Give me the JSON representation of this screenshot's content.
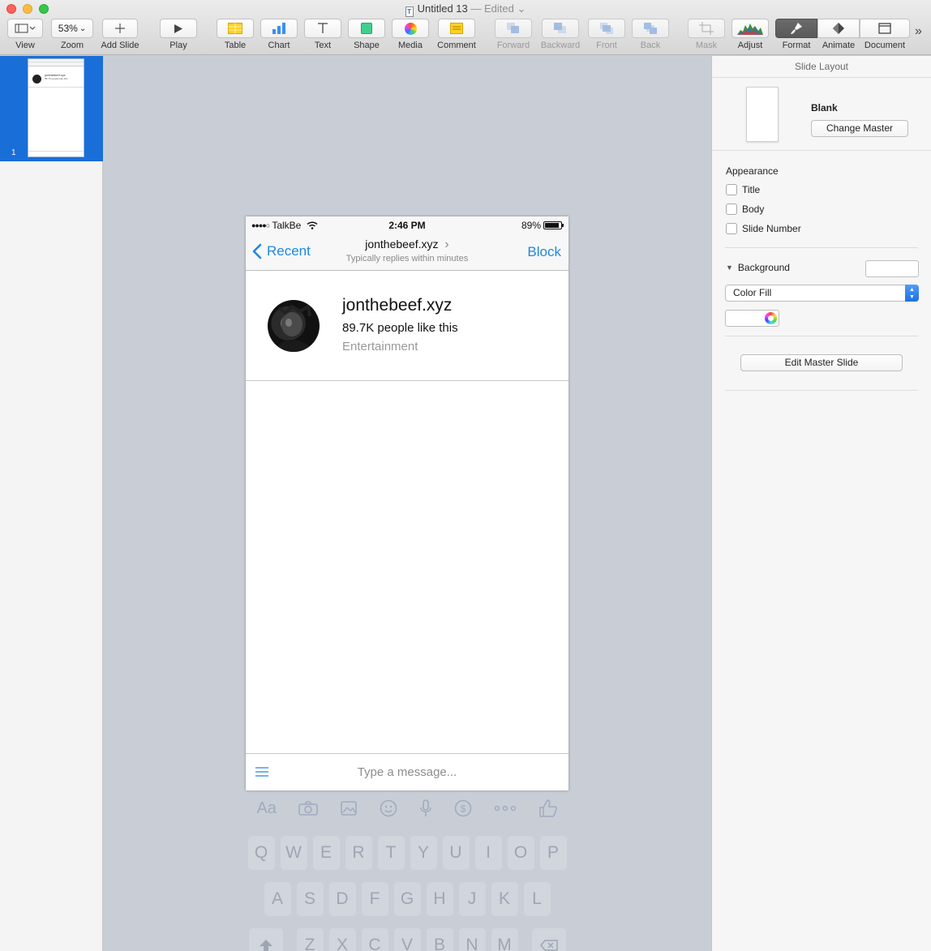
{
  "window": {
    "title": "Untitled 13",
    "status": "— Edited",
    "doc_icon_letter": "T"
  },
  "toolbar": {
    "view": {
      "label": "View",
      "icon": "sidebar-layout-icon"
    },
    "zoom": {
      "label": "Zoom",
      "value": "53%"
    },
    "add_slide": {
      "label": "Add Slide",
      "icon": "plus-icon"
    },
    "play": {
      "label": "Play",
      "icon": "play-icon"
    },
    "table": {
      "label": "Table",
      "icon": "table-icon"
    },
    "chart": {
      "label": "Chart",
      "icon": "bar-chart-icon"
    },
    "text": {
      "label": "Text",
      "icon": "text-t-icon"
    },
    "shape": {
      "label": "Shape",
      "icon": "shape-square-icon"
    },
    "media": {
      "label": "Media",
      "icon": "photos-flower-icon"
    },
    "comment": {
      "label": "Comment",
      "icon": "comment-note-icon"
    },
    "forward": {
      "label": "Forward",
      "enabled": false
    },
    "backward": {
      "label": "Backward",
      "enabled": false
    },
    "front": {
      "label": "Front",
      "enabled": false
    },
    "back": {
      "label": "Back",
      "enabled": false
    },
    "mask": {
      "label": "Mask",
      "enabled": false
    },
    "adjust": {
      "label": "Adjust",
      "icon": "histogram-icon"
    },
    "format": {
      "label": "Format",
      "icon": "paintbrush-icon",
      "active": true
    },
    "animate": {
      "label": "Animate",
      "icon": "diamond-icon"
    },
    "document": {
      "label": "Document",
      "icon": "document-rect-icon"
    },
    "overflow": "»"
  },
  "navigator": {
    "slide_number": "1",
    "thumb": {
      "name": "jonthebeef.xyz",
      "likes": "89.7K people like this"
    }
  },
  "slide": {
    "status_bar": {
      "signal": "●●●●○",
      "carrier": "TalkBe",
      "time": "2:46 PM",
      "battery_text": "89%",
      "battery_level": 0.89
    },
    "nav": {
      "back_label": "Recent",
      "title": "jonthebeef.xyz",
      "title_chevron": "›",
      "subtitle": "Typically replies within minutes",
      "block_label": "Block"
    },
    "profile": {
      "name": "jonthebeef.xyz",
      "likes": "89.7K people like this",
      "category": "Entertainment"
    },
    "composer": {
      "placeholder": "Type a message..."
    }
  },
  "keyboard": {
    "tools": [
      "Aa",
      "camera-icon",
      "photo-icon",
      "emoji-icon",
      "mic-icon",
      "dollar-icon",
      "more-icon",
      "thumbs-up-icon"
    ],
    "row1": [
      "Q",
      "W",
      "E",
      "R",
      "T",
      "Y",
      "U",
      "I",
      "O",
      "P"
    ],
    "row2": [
      "A",
      "S",
      "D",
      "F",
      "G",
      "H",
      "J",
      "K",
      "L"
    ],
    "row3": [
      "Z",
      "X",
      "C",
      "V",
      "B",
      "N",
      "M"
    ]
  },
  "inspector": {
    "header": "Slide Layout",
    "master_name": "Blank",
    "change_master": "Change Master",
    "appearance_title": "Appearance",
    "appearance_options": [
      {
        "label": "Title",
        "checked": false
      },
      {
        "label": "Body",
        "checked": false
      },
      {
        "label": "Slide Number",
        "checked": false
      }
    ],
    "background_title": "Background",
    "fill_type": "Color Fill",
    "fill_color": "#ffffff",
    "edit_master": "Edit Master Slide"
  },
  "colors": {
    "ios_blue": "#1e88e5",
    "selection_blue": "#1a6ed8",
    "canvas_gray": "#c9ced6"
  }
}
